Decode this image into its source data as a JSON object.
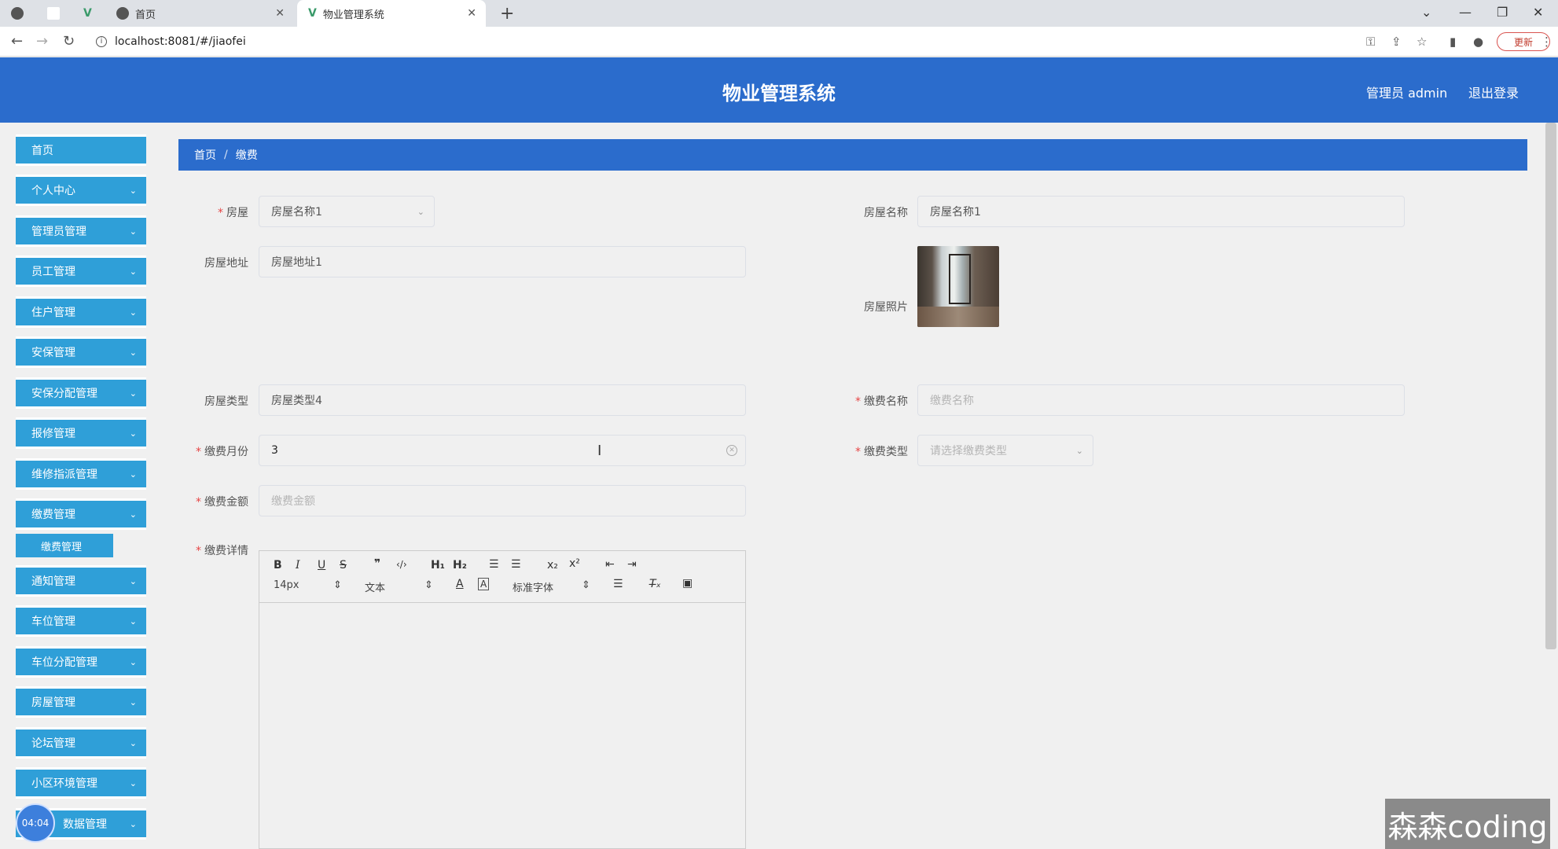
{
  "browser": {
    "tabs": [
      {
        "label": ""
      },
      {
        "label": ""
      },
      {
        "label": "首页"
      },
      {
        "label": "物业管理系统"
      }
    ],
    "url": "localhost:8081/#/jiaofei",
    "update_label": "更新"
  },
  "header": {
    "title": "物业管理系统",
    "user": "管理员 admin",
    "logout": "退出登录"
  },
  "sidebar": {
    "items": [
      {
        "label": "首页"
      },
      {
        "label": "个人中心"
      },
      {
        "label": "管理员管理"
      },
      {
        "label": "员工管理"
      },
      {
        "label": "住户管理"
      },
      {
        "label": "安保管理"
      },
      {
        "label": "安保分配管理"
      },
      {
        "label": "报修管理"
      },
      {
        "label": "维修指派管理"
      },
      {
        "label": "缴费管理"
      },
      {
        "label": "缴费管理"
      },
      {
        "label": "通知管理"
      },
      {
        "label": "车位管理"
      },
      {
        "label": "车位分配管理"
      },
      {
        "label": "房屋管理"
      },
      {
        "label": "论坛管理"
      },
      {
        "label": "小区环境管理"
      },
      {
        "label": "数据管理"
      }
    ],
    "timer": "04:04"
  },
  "breadcrumb": {
    "home": "首页",
    "sep": "/",
    "current": "缴费"
  },
  "form": {
    "house_label": "房屋",
    "house_value": "房屋名称1",
    "house_name_label": "房屋名称",
    "house_name_value": "房屋名称1",
    "house_address_label": "房屋地址",
    "house_address_value": "房屋地址1",
    "house_photo_label": "房屋照片",
    "house_type_label": "房屋类型",
    "house_type_value": "房屋类型4",
    "fee_name_label": "缴费名称",
    "fee_name_placeholder": "缴费名称",
    "fee_month_label": "缴费月份",
    "fee_month_value": "3",
    "fee_type_label": "缴费类型",
    "fee_type_placeholder": "请选择缴费类型",
    "fee_amount_label": "缴费金额",
    "fee_amount_placeholder": "缴费金额",
    "fee_detail_label": "缴费详情",
    "required_mark": "*"
  },
  "editor": {
    "font_size": "14px",
    "block_type": "文本",
    "font_family": "标准字体"
  },
  "watermark": "森森coding"
}
